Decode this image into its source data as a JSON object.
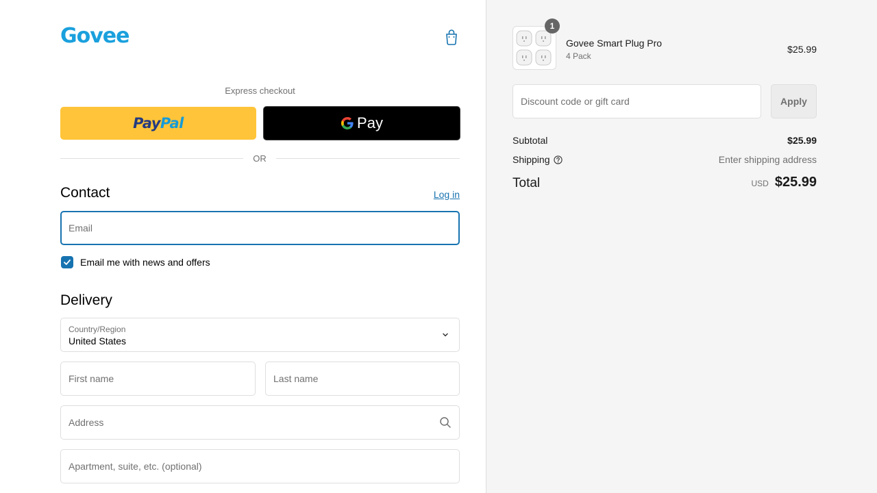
{
  "brand": {
    "name": "Govee",
    "color": "#1aa0dd"
  },
  "header": {
    "cart_icon": "shopping-bag-icon"
  },
  "express": {
    "label": "Express checkout",
    "paypal_pay": "Pay",
    "paypal_pal": "Pal",
    "gpay_label": "Pay",
    "or_text": "OR"
  },
  "contact": {
    "title": "Contact",
    "login_link": "Log in",
    "email_placeholder": "Email",
    "newsletter_label": "Email me with news and offers",
    "newsletter_checked": true
  },
  "delivery": {
    "title": "Delivery",
    "country_label": "Country/Region",
    "country_value": "United States",
    "first_name_placeholder": "First name",
    "last_name_placeholder": "Last name",
    "address_placeholder": "Address",
    "apartment_placeholder": "Apartment, suite, etc. (optional)"
  },
  "summary": {
    "product": {
      "name": "Govee Smart Plug Pro",
      "variant": "4 Pack",
      "price": "$25.99",
      "quantity": "1"
    },
    "discount_placeholder": "Discount code or gift card",
    "apply_label": "Apply",
    "subtotal_label": "Subtotal",
    "subtotal_value": "$25.99",
    "shipping_label": "Shipping",
    "shipping_value": "Enter shipping address",
    "total_label": "Total",
    "currency": "USD",
    "total_value": "$25.99"
  },
  "colors": {
    "accent": "#1773b0",
    "paypal_yellow": "#ffc439",
    "summary_bg": "#f5f5f5"
  }
}
